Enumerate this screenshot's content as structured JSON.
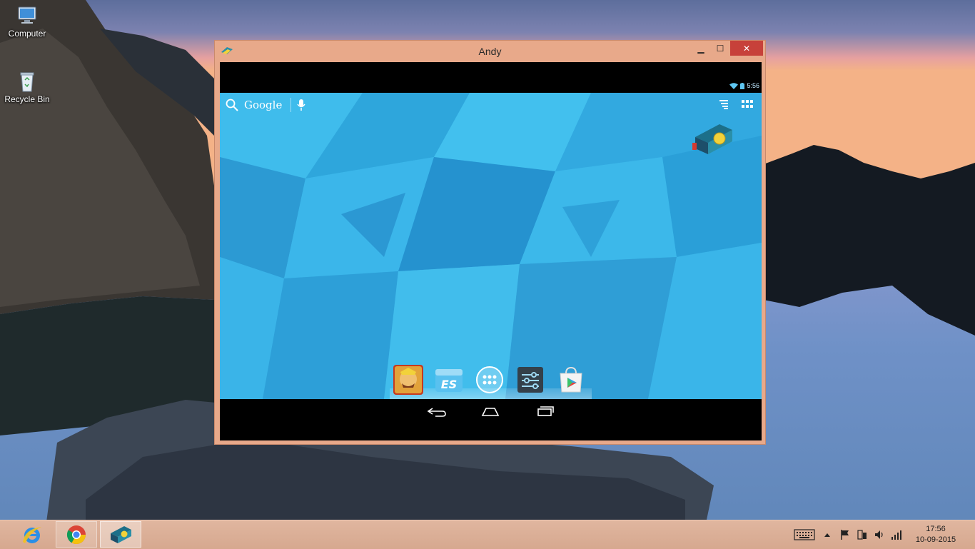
{
  "desktop": {
    "icons": [
      {
        "label": "Computer",
        "icon": "computer-icon"
      },
      {
        "label": "Recycle Bin",
        "icon": "recycle-bin-icon"
      }
    ]
  },
  "window": {
    "title": "Andy",
    "app_icon": "andy-icon",
    "controls": {
      "minimize": "▁",
      "maximize": "☐",
      "close": "✕"
    },
    "accent_color": "#e8a98a"
  },
  "android": {
    "status": {
      "time": "5:56",
      "icons": [
        "wifi-icon",
        "battery-icon"
      ]
    },
    "search": {
      "label": "Google",
      "icons": [
        "search-icon",
        "microphone-icon"
      ]
    },
    "top_right_icons": [
      "widget-list-icon",
      "app-grid-icon"
    ],
    "widget": "andy-launcher-icon",
    "dock": [
      {
        "name": "clash-of-clans-icon"
      },
      {
        "name": "es-file-explorer-icon"
      },
      {
        "name": "all-apps-icon"
      },
      {
        "name": "settings-icon"
      },
      {
        "name": "play-store-icon"
      }
    ],
    "nav": [
      "back-icon",
      "home-icon",
      "recent-apps-icon"
    ]
  },
  "taskbar": {
    "pinned": [
      {
        "name": "internet-explorer-icon"
      },
      {
        "name": "chrome-icon"
      },
      {
        "name": "andy-icon"
      }
    ],
    "tray_icons": [
      "keyboard-icon",
      "show-hidden-icons-icon",
      "flag-icon",
      "network-icon",
      "volume-icon",
      "signal-icon"
    ],
    "clock": {
      "time": "17:56",
      "date": "10-09-2015"
    }
  }
}
